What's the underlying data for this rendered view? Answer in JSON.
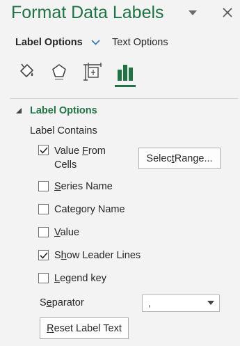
{
  "pane": {
    "title": "Format Data Labels",
    "menu_icon": "chevron-down-icon",
    "close_label": "✕"
  },
  "tabs": [
    {
      "label": "Label Options",
      "selected": true
    },
    {
      "label": "Text Options",
      "selected": false
    }
  ],
  "category_icons": [
    {
      "name": "fill-line-icon",
      "selected": false
    },
    {
      "name": "effects-icon",
      "selected": false
    },
    {
      "name": "size-properties-icon",
      "selected": false
    },
    {
      "name": "label-options-icon",
      "selected": true
    }
  ],
  "section": {
    "title": "Label Options",
    "group_label": "Label Contains",
    "options": [
      {
        "key": "value_from_cells",
        "pre": "Value ",
        "ul": "F",
        "post": "rom",
        "line2": "Cells",
        "checked": true
      },
      {
        "key": "series_name",
        "pre": "",
        "ul": "S",
        "post": "eries Name",
        "checked": false
      },
      {
        "key": "category_name",
        "pre": "Cate",
        "ul": "g",
        "post": "ory Name",
        "checked": false
      },
      {
        "key": "value",
        "pre": "",
        "ul": "V",
        "post": "alue",
        "checked": false
      },
      {
        "key": "show_leader_lines",
        "pre": "S",
        "ul": "h",
        "post": "ow Leader Lines",
        "checked": true
      },
      {
        "key": "legend_key",
        "pre": "",
        "ul": "L",
        "post": "egend key",
        "checked": false
      }
    ],
    "select_range": {
      "pre": "Selec",
      "ul": "t",
      "post": " Range..."
    },
    "separator": {
      "pre": "S",
      "ul": "e",
      "post": "parator",
      "value": ","
    },
    "reset": {
      "pre": "",
      "ul": "R",
      "post": "eset Label Text"
    }
  },
  "colors": {
    "accent": "#217346",
    "background": "#f3f3f3",
    "check": "#262626"
  }
}
